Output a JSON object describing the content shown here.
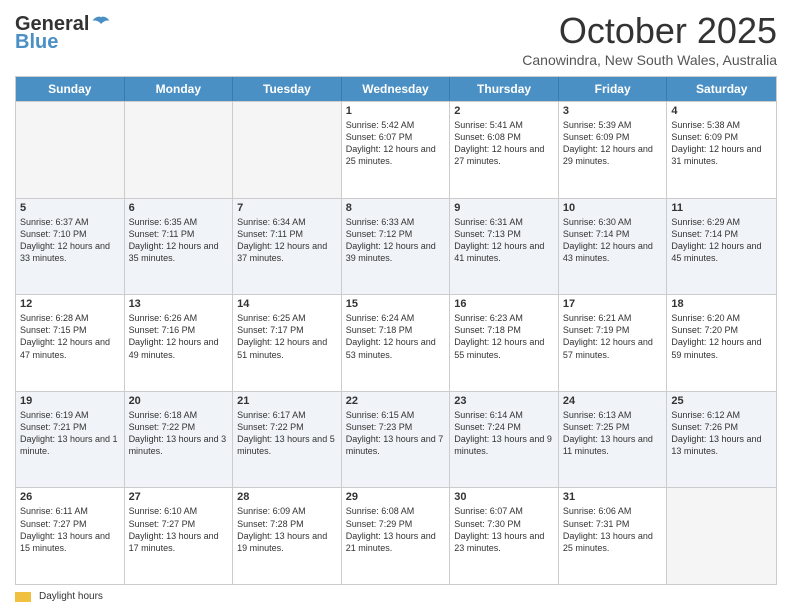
{
  "header": {
    "logo_general": "General",
    "logo_blue": "Blue",
    "month_title": "October 2025",
    "subtitle": "Canowindra, New South Wales, Australia"
  },
  "days_of_week": [
    "Sunday",
    "Monday",
    "Tuesday",
    "Wednesday",
    "Thursday",
    "Friday",
    "Saturday"
  ],
  "weeks": [
    [
      {
        "day": "",
        "empty": true
      },
      {
        "day": "",
        "empty": true
      },
      {
        "day": "",
        "empty": true
      },
      {
        "day": "1",
        "sunrise": "Sunrise: 5:42 AM",
        "sunset": "Sunset: 6:07 PM",
        "daylight": "Daylight: 12 hours and 25 minutes."
      },
      {
        "day": "2",
        "sunrise": "Sunrise: 5:41 AM",
        "sunset": "Sunset: 6:08 PM",
        "daylight": "Daylight: 12 hours and 27 minutes."
      },
      {
        "day": "3",
        "sunrise": "Sunrise: 5:39 AM",
        "sunset": "Sunset: 6:09 PM",
        "daylight": "Daylight: 12 hours and 29 minutes."
      },
      {
        "day": "4",
        "sunrise": "Sunrise: 5:38 AM",
        "sunset": "Sunset: 6:09 PM",
        "daylight": "Daylight: 12 hours and 31 minutes."
      }
    ],
    [
      {
        "day": "5",
        "sunrise": "Sunrise: 6:37 AM",
        "sunset": "Sunset: 7:10 PM",
        "daylight": "Daylight: 12 hours and 33 minutes."
      },
      {
        "day": "6",
        "sunrise": "Sunrise: 6:35 AM",
        "sunset": "Sunset: 7:11 PM",
        "daylight": "Daylight: 12 hours and 35 minutes."
      },
      {
        "day": "7",
        "sunrise": "Sunrise: 6:34 AM",
        "sunset": "Sunset: 7:11 PM",
        "daylight": "Daylight: 12 hours and 37 minutes."
      },
      {
        "day": "8",
        "sunrise": "Sunrise: 6:33 AM",
        "sunset": "Sunset: 7:12 PM",
        "daylight": "Daylight: 12 hours and 39 minutes."
      },
      {
        "day": "9",
        "sunrise": "Sunrise: 6:31 AM",
        "sunset": "Sunset: 7:13 PM",
        "daylight": "Daylight: 12 hours and 41 minutes."
      },
      {
        "day": "10",
        "sunrise": "Sunrise: 6:30 AM",
        "sunset": "Sunset: 7:14 PM",
        "daylight": "Daylight: 12 hours and 43 minutes."
      },
      {
        "day": "11",
        "sunrise": "Sunrise: 6:29 AM",
        "sunset": "Sunset: 7:14 PM",
        "daylight": "Daylight: 12 hours and 45 minutes."
      }
    ],
    [
      {
        "day": "12",
        "sunrise": "Sunrise: 6:28 AM",
        "sunset": "Sunset: 7:15 PM",
        "daylight": "Daylight: 12 hours and 47 minutes."
      },
      {
        "day": "13",
        "sunrise": "Sunrise: 6:26 AM",
        "sunset": "Sunset: 7:16 PM",
        "daylight": "Daylight: 12 hours and 49 minutes."
      },
      {
        "day": "14",
        "sunrise": "Sunrise: 6:25 AM",
        "sunset": "Sunset: 7:17 PM",
        "daylight": "Daylight: 12 hours and 51 minutes."
      },
      {
        "day": "15",
        "sunrise": "Sunrise: 6:24 AM",
        "sunset": "Sunset: 7:18 PM",
        "daylight": "Daylight: 12 hours and 53 minutes."
      },
      {
        "day": "16",
        "sunrise": "Sunrise: 6:23 AM",
        "sunset": "Sunset: 7:18 PM",
        "daylight": "Daylight: 12 hours and 55 minutes."
      },
      {
        "day": "17",
        "sunrise": "Sunrise: 6:21 AM",
        "sunset": "Sunset: 7:19 PM",
        "daylight": "Daylight: 12 hours and 57 minutes."
      },
      {
        "day": "18",
        "sunrise": "Sunrise: 6:20 AM",
        "sunset": "Sunset: 7:20 PM",
        "daylight": "Daylight: 12 hours and 59 minutes."
      }
    ],
    [
      {
        "day": "19",
        "sunrise": "Sunrise: 6:19 AM",
        "sunset": "Sunset: 7:21 PM",
        "daylight": "Daylight: 13 hours and 1 minute."
      },
      {
        "day": "20",
        "sunrise": "Sunrise: 6:18 AM",
        "sunset": "Sunset: 7:22 PM",
        "daylight": "Daylight: 13 hours and 3 minutes."
      },
      {
        "day": "21",
        "sunrise": "Sunrise: 6:17 AM",
        "sunset": "Sunset: 7:22 PM",
        "daylight": "Daylight: 13 hours and 5 minutes."
      },
      {
        "day": "22",
        "sunrise": "Sunrise: 6:15 AM",
        "sunset": "Sunset: 7:23 PM",
        "daylight": "Daylight: 13 hours and 7 minutes."
      },
      {
        "day": "23",
        "sunrise": "Sunrise: 6:14 AM",
        "sunset": "Sunset: 7:24 PM",
        "daylight": "Daylight: 13 hours and 9 minutes."
      },
      {
        "day": "24",
        "sunrise": "Sunrise: 6:13 AM",
        "sunset": "Sunset: 7:25 PM",
        "daylight": "Daylight: 13 hours and 11 minutes."
      },
      {
        "day": "25",
        "sunrise": "Sunrise: 6:12 AM",
        "sunset": "Sunset: 7:26 PM",
        "daylight": "Daylight: 13 hours and 13 minutes."
      }
    ],
    [
      {
        "day": "26",
        "sunrise": "Sunrise: 6:11 AM",
        "sunset": "Sunset: 7:27 PM",
        "daylight": "Daylight: 13 hours and 15 minutes."
      },
      {
        "day": "27",
        "sunrise": "Sunrise: 6:10 AM",
        "sunset": "Sunset: 7:27 PM",
        "daylight": "Daylight: 13 hours and 17 minutes."
      },
      {
        "day": "28",
        "sunrise": "Sunrise: 6:09 AM",
        "sunset": "Sunset: 7:28 PM",
        "daylight": "Daylight: 13 hours and 19 minutes."
      },
      {
        "day": "29",
        "sunrise": "Sunrise: 6:08 AM",
        "sunset": "Sunset: 7:29 PM",
        "daylight": "Daylight: 13 hours and 21 minutes."
      },
      {
        "day": "30",
        "sunrise": "Sunrise: 6:07 AM",
        "sunset": "Sunset: 7:30 PM",
        "daylight": "Daylight: 13 hours and 23 minutes."
      },
      {
        "day": "31",
        "sunrise": "Sunrise: 6:06 AM",
        "sunset": "Sunset: 7:31 PM",
        "daylight": "Daylight: 13 hours and 25 minutes."
      },
      {
        "day": "",
        "empty": true
      }
    ]
  ],
  "footer": {
    "daylight_label": "Daylight hours"
  }
}
